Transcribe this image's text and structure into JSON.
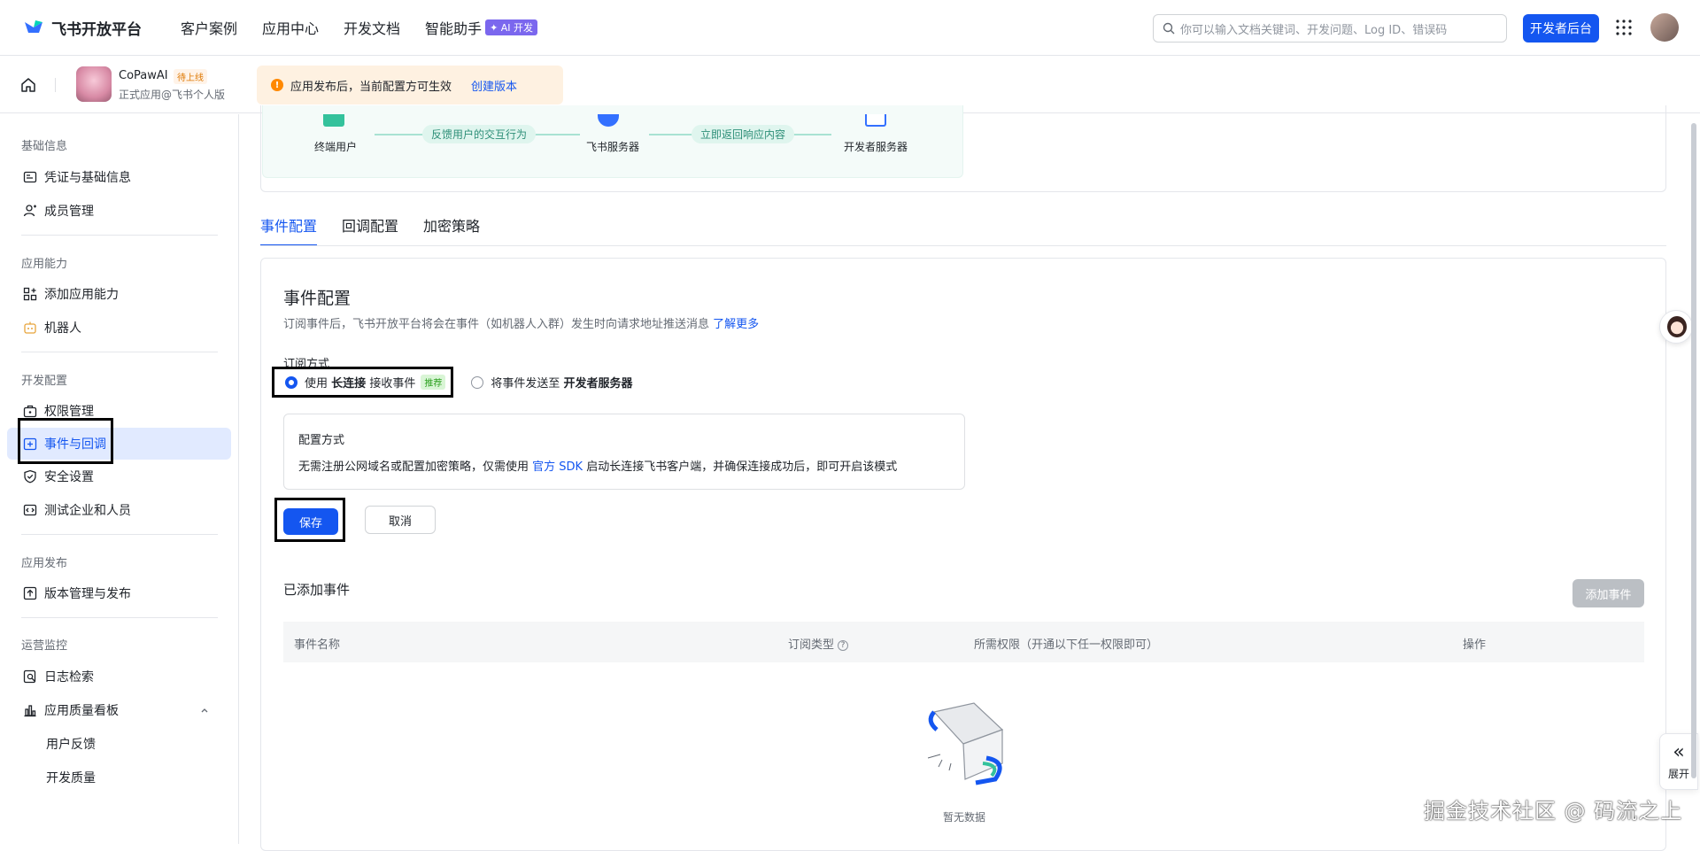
{
  "topbar": {
    "logo_text": "飞书开放平台",
    "nav": [
      "客户案例",
      "应用中心",
      "开发文档",
      "智能助手"
    ],
    "ai_badge": "✦ AI 开发",
    "search_placeholder": "你可以输入文档关键词、开发问题、Log ID、错误码",
    "dev_console": "开发者后台"
  },
  "appbar": {
    "app_name": "CoPawAI",
    "app_status": "待上线",
    "app_sub": "正式应用@飞书个人版",
    "notice_text": "应用发布后，当前配置方可生效",
    "notice_link": "创建版本"
  },
  "sidebar": {
    "sections": [
      {
        "title": "基础信息",
        "items": [
          "凭证与基础信息",
          "成员管理"
        ]
      },
      {
        "title": "应用能力",
        "items": [
          "添加应用能力",
          "机器人"
        ]
      },
      {
        "title": "开发配置",
        "items": [
          "权限管理",
          "事件与回调",
          "安全设置",
          "测试企业和人员"
        ]
      },
      {
        "title": "应用发布",
        "items": [
          "版本管理与发布"
        ]
      },
      {
        "title": "运营监控",
        "items": [
          "日志检索",
          "应用质量看板",
          "用户反馈",
          "开发质量"
        ]
      }
    ],
    "active": "事件与回调"
  },
  "diagram": {
    "nodes": [
      "终端用户",
      "飞书服务器",
      "开发者服务器"
    ],
    "arrows": [
      "反馈用户的交互行为",
      "立即返回响应内容"
    ]
  },
  "tabs": [
    "事件配置",
    "回调配置",
    "加密策略"
  ],
  "event_config": {
    "title": "事件配置",
    "desc": "订阅事件后，飞书开放平台将会在事件（如机器人入群）发生时向请求地址推送消息",
    "desc_link": "了解更多",
    "sub_label": "订阅方式",
    "option1_pre": "使用",
    "option1_bold": "长连接",
    "option1_post": "接收事件",
    "option1_tag": "推荐",
    "option2_pre": "将事件发送至",
    "option2_bold": "开发者服务器",
    "cfg_title": "配置方式",
    "cfg_text_pre": "无需注册公网域名或配置加密策略，仅需使用",
    "cfg_text_link": "官方 SDK",
    "cfg_text_post": "启动长连接飞书客户端，并确保连接成功后，即可开启该模式",
    "save": "保存",
    "cancel": "取消"
  },
  "added_events": {
    "title": "已添加事件",
    "add_button": "添加事件",
    "columns": [
      "事件名称",
      "订阅类型",
      "所需权限（开通以下任一权限即可）",
      "操作"
    ],
    "rows": [],
    "empty_text": "暂无数据"
  },
  "expand_panel": {
    "arrow": "«",
    "label": "展开"
  },
  "watermark": "掘金技术社区 @ 码流之上",
  "colors": {
    "primary": "#1456f0",
    "active_bg": "#e1eaff",
    "notice_bg": "#fef1e1"
  }
}
